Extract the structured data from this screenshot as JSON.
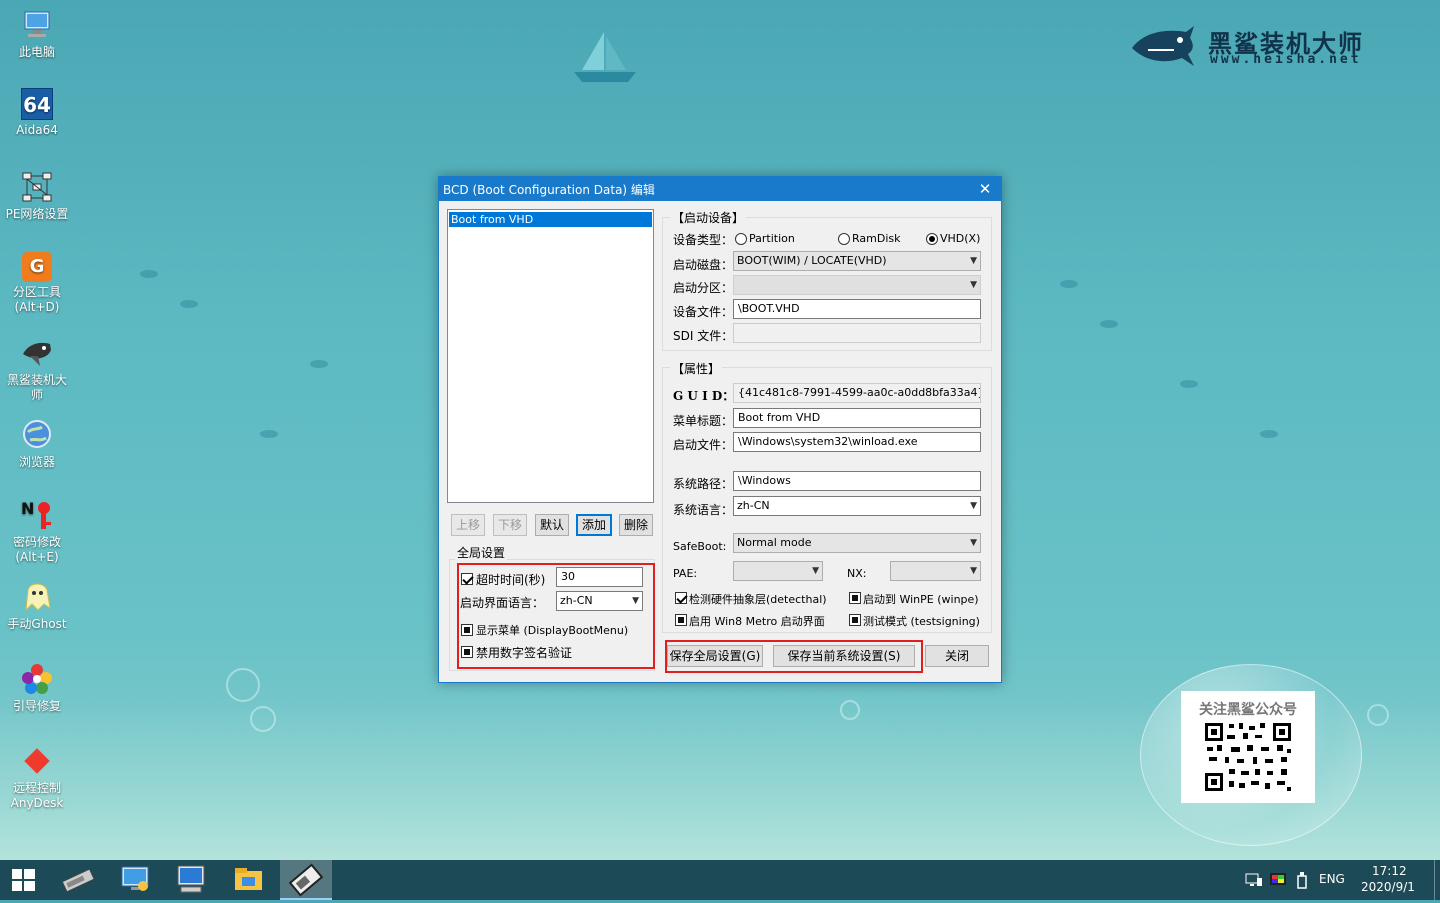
{
  "brand": {
    "name": "黑鲨装机大师",
    "url": "www.heisha.net"
  },
  "desktop_icons": [
    {
      "label": "此电脑",
      "icon": "computer-icon"
    },
    {
      "label": "Aida64",
      "icon": "aida64-icon",
      "badge": "64"
    },
    {
      "label": "PE网络设置",
      "icon": "network-icon"
    },
    {
      "label": "分区工具\n(Alt+D)",
      "icon": "partition-tool-icon"
    },
    {
      "label": "黑鲨装机大\n师",
      "icon": "shark-icon"
    },
    {
      "label": "浏览器",
      "icon": "browser-icon"
    },
    {
      "label": "密码修改\n(Alt+E)",
      "icon": "password-icon"
    },
    {
      "label": "手动Ghost",
      "icon": "ghost-icon"
    },
    {
      "label": "引导修复",
      "icon": "boot-repair-icon"
    },
    {
      "label": "远程控制\nAnyDesk",
      "icon": "anydesk-icon"
    }
  ],
  "qr": {
    "title": "关注黑鲨公众号"
  },
  "dialog": {
    "title": "BCD (Boot Configuration Data) 编辑",
    "entries": [
      "Boot from VHD"
    ],
    "list_buttons": {
      "up": "上移",
      "down": "下移",
      "default": "默认",
      "add": "添加",
      "delete": "删除"
    },
    "global": {
      "title": "全局设置",
      "timeout_label": "超时时间(秒)",
      "timeout_value": "30",
      "lang_label": "启动界面语言：",
      "lang_value": "zh-CN",
      "show_menu": "显示菜单 (DisplayBootMenu)",
      "disable_sig": "禁用数字签名验证"
    },
    "boot_device": {
      "title": "【启动设备】",
      "type_label": "设备类型：",
      "types": [
        "Partition",
        "RamDisk",
        "VHD(X)"
      ],
      "selected_type": "VHD(X)",
      "disk_label": "启动磁盘：",
      "disk_value": "BOOT(WIM) / LOCATE(VHD)",
      "partition_label": "启动分区：",
      "file_label": "设备文件：",
      "file_value": "\\BOOT.VHD",
      "sdi_label": "SDI 文件："
    },
    "properties": {
      "title": "【属性】",
      "guid_label": "G U I D：",
      "guid_value": "{41c481c8-7991-4599-aa0c-a0dd8bfa33a4}",
      "menu_title_label": "菜单标题：",
      "menu_title_value": "Boot from VHD",
      "boot_file_label": "启动文件：",
      "boot_file_value": "\\Windows\\system32\\winload.exe",
      "sys_path_label": "系统路径：",
      "sys_path_value": "\\Windows",
      "sys_lang_label": "系统语言：",
      "sys_lang_value": "zh-CN",
      "safeboot_label": "SafeBoot:",
      "safeboot_value": "Normal mode",
      "pae_label": "PAE:",
      "nx_label": "NX:",
      "detecthal": "检测硬件抽象层(detecthal)",
      "winpe": "启动到 WinPE (winpe)",
      "metro": "启用 Win8 Metro 启动界面",
      "testsigning": "测试模式 (testsigning)"
    },
    "buttons": {
      "save_global": "保存全局设置(G)",
      "save_current": "保存当前系统设置(S)",
      "close": "关闭"
    }
  },
  "taskbar": {
    "items": [
      "start-icon",
      "disk-tool-icon",
      "system-settings-icon",
      "network-monitor-icon",
      "file-explorer-icon",
      "bcd-editor-icon"
    ],
    "lang": "ENG",
    "time": "17:12",
    "date": "2020/9/1"
  }
}
